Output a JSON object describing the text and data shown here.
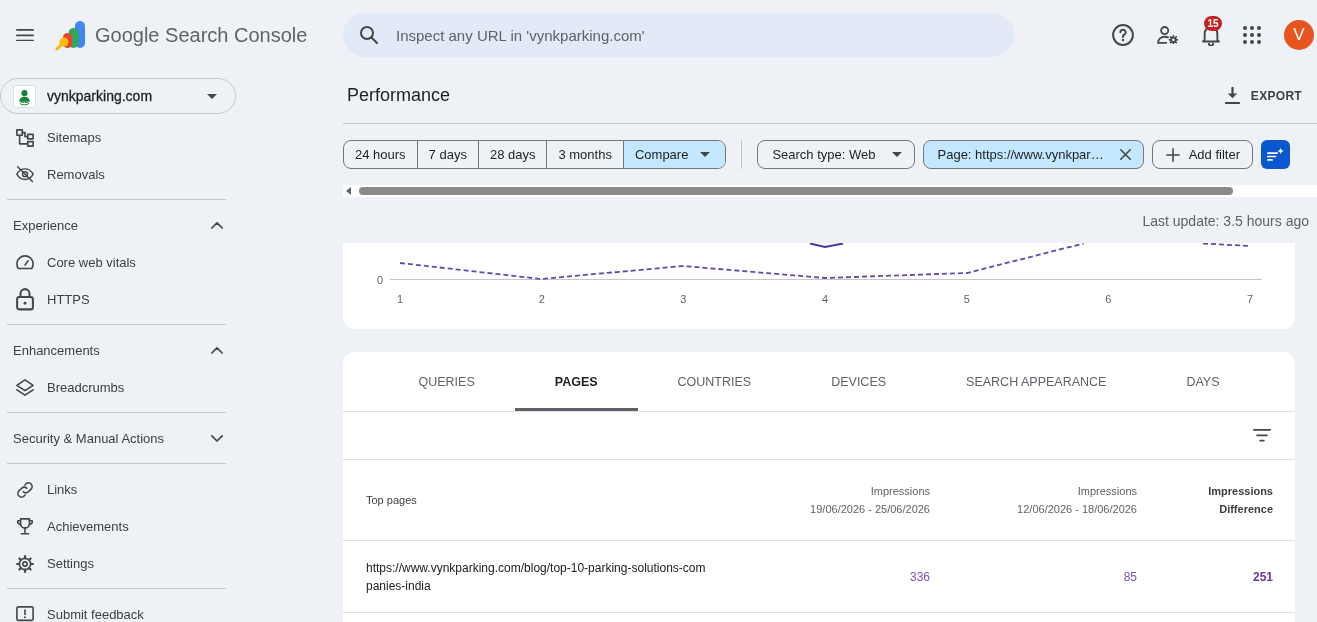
{
  "header": {
    "product_name": "Google Search Console",
    "search": {
      "placeholder": "Inspect any URL in 'vynkparking.com'"
    },
    "notification_count": "15",
    "avatar_initial": "V"
  },
  "sidebar": {
    "property": "vynkparking.com",
    "sections": [
      {
        "items": [
          {
            "label": "Sitemaps"
          },
          {
            "label": "Removals"
          }
        ]
      },
      {
        "title": "Experience",
        "expanded": true,
        "items": [
          {
            "label": "Core web vitals"
          },
          {
            "label": "HTTPS"
          }
        ]
      },
      {
        "title": "Enhancements",
        "expanded": true,
        "items": [
          {
            "label": "Breadcrumbs"
          }
        ]
      },
      {
        "title": "Security & Manual Actions",
        "expanded": false
      },
      {
        "items": [
          {
            "label": "Links"
          },
          {
            "label": "Achievements"
          },
          {
            "label": "Settings"
          }
        ]
      },
      {
        "items": [
          {
            "label": "Submit feedback"
          }
        ]
      }
    ]
  },
  "performance": {
    "title": "Performance",
    "export_label": "EXPORT",
    "date_ranges": [
      {
        "kind": "option",
        "label": "24 hours",
        "selected": false
      },
      {
        "kind": "option",
        "label": "7 days",
        "selected": false
      },
      {
        "kind": "option",
        "label": "28 days",
        "selected": false
      },
      {
        "kind": "option",
        "label": "3 months",
        "selected": false
      },
      {
        "kind": "menu",
        "label": "Compare",
        "selected": true
      }
    ],
    "filters": [
      {
        "kind": "dropdown",
        "label": "Search type: Web",
        "active": false
      },
      {
        "kind": "removable",
        "label": "Page: https://www.vynkpar…",
        "active": true
      },
      {
        "kind": "add",
        "label": "Add filter",
        "active": false
      }
    ],
    "last_update": "Last update: 3.5 hours ago"
  },
  "chart": {
    "y_labels": [
      "0"
    ],
    "x_labels": [
      "1",
      "2",
      "3",
      "4",
      "5",
      "6",
      "7"
    ]
  },
  "table": {
    "tabs": [
      {
        "label": "QUERIES",
        "selected": false
      },
      {
        "label": "PAGES",
        "selected": true
      },
      {
        "label": "COUNTRIES",
        "selected": false
      },
      {
        "label": "DEVICES",
        "selected": false
      },
      {
        "label": "SEARCH APPEARANCE",
        "selected": false
      },
      {
        "label": "DAYS",
        "selected": false
      }
    ],
    "columns": [
      {
        "kind": "label",
        "title": "Top pages"
      },
      {
        "kind": "period",
        "title": "Impressions",
        "subtitle": "19/06/2026 - 25/06/2026"
      },
      {
        "kind": "period",
        "title": "Impressions",
        "subtitle": "12/06/2026 - 18/06/2026"
      },
      {
        "kind": "difference",
        "title": "Impressions",
        "subtitle": "Difference"
      }
    ],
    "rows": [
      {
        "cells": [
          "https://www.vynkparking.com/blog/top-10-parking-solutions-companies-india",
          "336",
          "85",
          "251"
        ]
      }
    ]
  }
}
